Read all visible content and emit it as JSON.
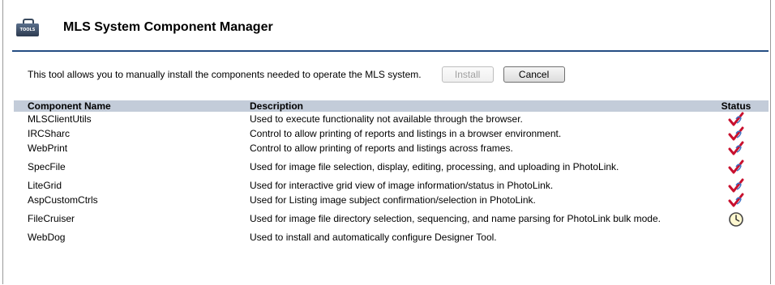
{
  "header": {
    "icon_label": "TOOLS",
    "title": "MLS System Component Manager"
  },
  "intro": {
    "text": "This tool allows you to manually install the components needed to operate the MLS system.",
    "install_label": "Install",
    "cancel_label": "Cancel"
  },
  "table": {
    "columns": [
      "Component Name",
      "Description",
      "Status"
    ],
    "rows": [
      {
        "name": "MLSClientUtils",
        "description": "Used to execute functionality not available through the browser.",
        "status": "installed"
      },
      {
        "name": "IRCSharc",
        "description": "Control to allow printing of reports and listings in a browser environment.",
        "status": "installed"
      },
      {
        "name": "WebPrint",
        "description": "Control to allow printing of reports and listings across frames.",
        "status": "installed"
      },
      {
        "name": "SpecFile",
        "description": "Used for image file selection, display, editing, processing, and uploading in PhotoLink.",
        "status": "installed"
      },
      {
        "name": "LiteGrid",
        "description": "Used for interactive grid view of image information/status in PhotoLink.",
        "status": "installed"
      },
      {
        "name": "AspCustomCtrls",
        "description": "Used for Listing image subject confirmation/selection in PhotoLink.",
        "status": "installed"
      },
      {
        "name": "FileCruiser",
        "description": "Used for image file directory selection, sequencing, and name parsing for PhotoLink bulk mode.",
        "status": "pending"
      },
      {
        "name": "WebDog",
        "description": "Used to install and automatically configure Designer Tool.",
        "status": "none"
      }
    ]
  },
  "colors": {
    "rule": "#254d83",
    "header_bg": "#c3ccd9",
    "check": "#c8102e"
  },
  "icons": {
    "installed": "checkmark-icon",
    "pending": "clock-icon"
  }
}
